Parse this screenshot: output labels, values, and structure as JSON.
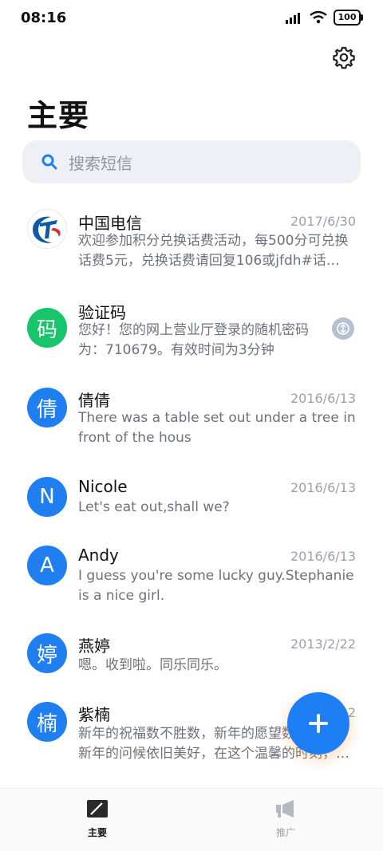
{
  "status": {
    "time": "08:16",
    "battery": "100"
  },
  "header": {
    "title": "主要"
  },
  "search": {
    "placeholder": "搜索短信"
  },
  "messages": [
    {
      "name": "中国电信",
      "date": "2017/6/30",
      "preview": "欢迎参加积分兑换话费活动，每500分可兑换话费5元，兑换话费请回复106或jfdh#话…",
      "avatar": "",
      "avatar_color": "#ffffff"
    },
    {
      "name": "验证码",
      "date": "",
      "preview": "您好！您的网上营业厅登录的随机密码为：710679。有效时间为3分钟",
      "avatar": "码",
      "avatar_color": "#19c56b"
    },
    {
      "name": "倩倩",
      "date": "2016/6/13",
      "preview": "There was a table set out under a tree in front of the hous",
      "avatar": "倩",
      "avatar_color": "#1f7ff0"
    },
    {
      "name": "Nicole",
      "date": "2016/6/13",
      "preview": "Let's eat out,shall we?",
      "avatar": "N",
      "avatar_color": "#1f7ff0"
    },
    {
      "name": "Andy",
      "date": "2016/6/13",
      "preview": "I guess you're some lucky guy.Stephanie is a nice girl.",
      "avatar": "A",
      "avatar_color": "#1f7ff0"
    },
    {
      "name": "燕婷",
      "date": "2013/2/22",
      "preview": "嗯。收到啦。同乐同乐。",
      "avatar": "婷",
      "avatar_color": "#1f7ff0"
    },
    {
      "name": "紫楠",
      "date": "2013/2/22",
      "preview": "新年的祝福数不胜数，新年的愿望数不胜数，新年的问候依旧美好，在这个温馨的时刻，…",
      "avatar": "楠",
      "avatar_color": "#1f7ff0"
    }
  ],
  "tabs": [
    {
      "label": "主要",
      "active": true
    },
    {
      "label": "推广",
      "active": false
    }
  ],
  "colors": {
    "accent": "#1e7ff5",
    "search_bg": "#eef0f5"
  }
}
